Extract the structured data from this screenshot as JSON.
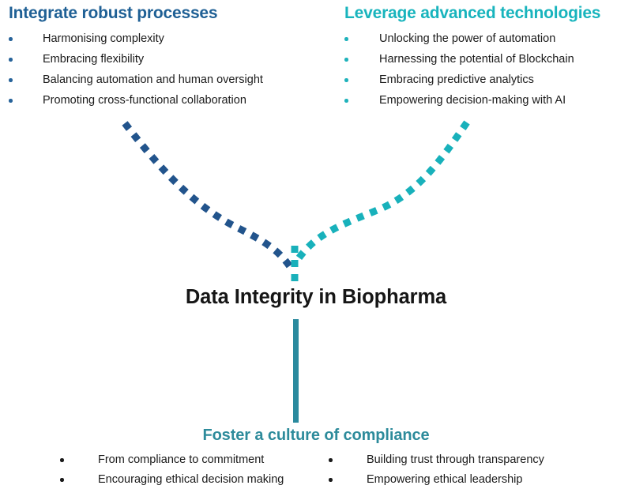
{
  "center": {
    "title": "Data Integrity in Biopharma"
  },
  "colors": {
    "blue": "#1f6095",
    "blue_bullet": "#27639a",
    "cyan": "#18b4bd",
    "cyan_bullet": "#1fb2bb",
    "teal_stem": "#2a8a9e",
    "teal_heading": "#2d8b9b",
    "text": "#1a1a1a",
    "title": "#161616",
    "background": "#ffffff"
  },
  "branches": {
    "left": {
      "heading": "Integrate robust processes",
      "items": [
        "Harmonising complexity",
        "Embracing flexibility",
        "Balancing automation and human oversight",
        "Promoting cross-functional collaboration"
      ]
    },
    "right": {
      "heading": "Leverage advanced technologies",
      "items": [
        "Unlocking the power of automation",
        "Harnessing the potential of Blockchain",
        "Embracing predictive analytics",
        "Empowering decision-making with AI"
      ]
    },
    "bottom": {
      "heading": "Foster a culture of compliance",
      "items_left": [
        "From compliance to commitment",
        "Encouraging ethical decision making"
      ],
      "items_right": [
        "Building trust through transparency",
        "Empowering ethical leadership"
      ]
    }
  },
  "connectors": {
    "left_arc": "dashed-curve-blue",
    "right_arc": "dashed-curve-cyan",
    "center_tail": "dashed-tail-cyan",
    "stem": "solid-bar-teal"
  }
}
